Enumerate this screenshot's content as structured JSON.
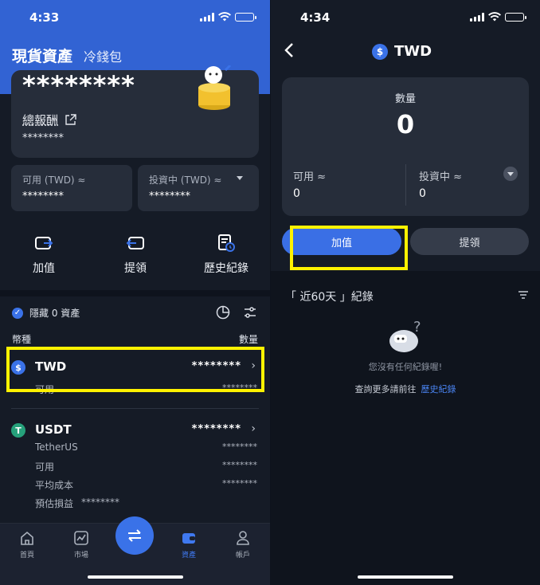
{
  "left": {
    "status": {
      "time": "4:33"
    },
    "header": {
      "title": "現貨資產",
      "subtitle": "冷錢包"
    },
    "card": {
      "total_masked": "********",
      "reward_label": "總報酬",
      "reward_value": "********"
    },
    "available": {
      "label": "可用 (TWD) ≈",
      "value": "********"
    },
    "investing": {
      "label": "投資中 (TWD) ≈",
      "value": "********"
    },
    "actions": [
      "加值",
      "提領",
      "歷史紀錄"
    ],
    "hide_label": "隱藏 0 資產",
    "col_coin": "幣種",
    "col_qty": "數量",
    "twd": {
      "name": "TWD",
      "amount": "********",
      "sub_label": "可用",
      "sub_value": "********"
    },
    "usdt": {
      "name": "USDT",
      "amount": "********",
      "fullname": "TetherUS",
      "fullname_value": "********",
      "available_label": "可用",
      "available_value": "********",
      "avg_cost_label": "平均成本",
      "avg_cost_value": "********",
      "pnl_label": "預估損益",
      "pnl_value": "********"
    },
    "tabs": [
      "首頁",
      "市場",
      "資產",
      "帳戶"
    ]
  },
  "right": {
    "status": {
      "time": "4:34"
    },
    "title": "TWD",
    "qty_label": "數量",
    "qty_value": "0",
    "available_label": "可用 ≈",
    "available_value": "0",
    "investing_label": "投資中 ≈",
    "investing_value": "0",
    "deposit": "加值",
    "withdraw": "提領",
    "records_title": "「 近60天 」紀錄",
    "empty_text": "您沒有任何紀錄喔!",
    "more_text": "查詢更多請前往",
    "more_link": "歷史紀錄"
  },
  "colors": {
    "brand_blue": "#3263d3",
    "accent": "#3a72e8",
    "highlight": "#fff200",
    "usdt_green": "#26a17b"
  }
}
